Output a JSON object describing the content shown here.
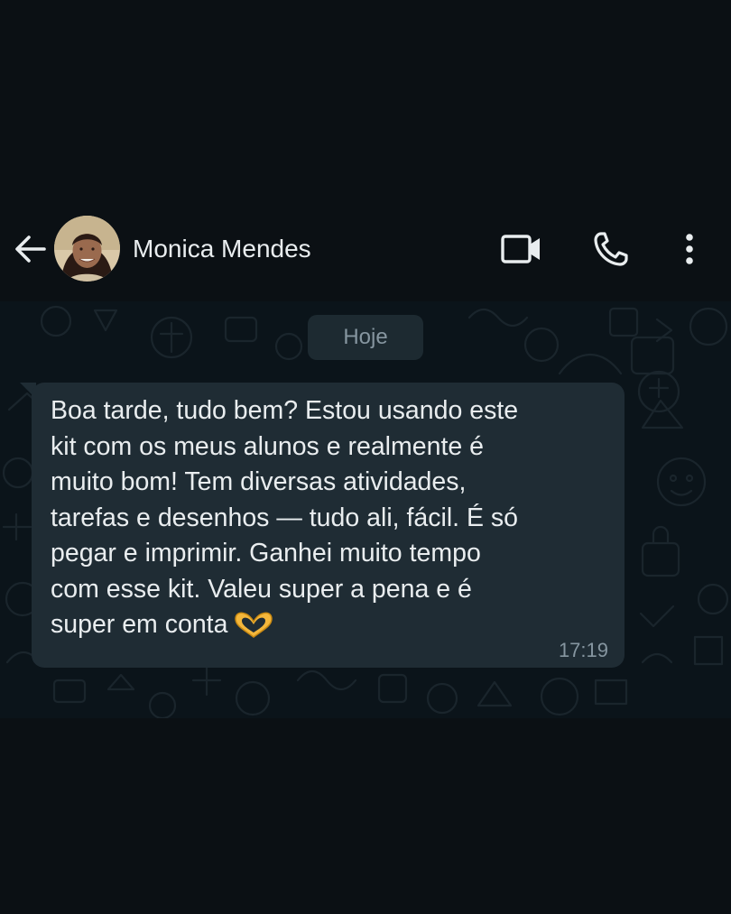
{
  "header": {
    "contact_name": "Monica Mendes"
  },
  "chat": {
    "date_chip": "Hoje",
    "messages": [
      {
        "text": "Boa tarde, tudo bem? Estou usando este\nkit com os meus alunos e realmente é\nmuito bom! Tem diversas atividades,\ntarefas e desenhos — tudo ali, fácil. É só\npegar e imprimir. Ganhei muito tempo\ncom esse kit. Valeu super a pena e é\nsuper em conta",
        "emoji": "heart-hands-emoji",
        "time": "17:19"
      }
    ]
  },
  "colors": {
    "background": "#0b1014",
    "chat_wallpaper": "#0b141a",
    "incoming_bubble": "#1f2c34",
    "primary_text": "#e9edef",
    "secondary_text": "#8696a0"
  },
  "icons": [
    "back-arrow-icon",
    "video-call-icon",
    "phone-call-icon",
    "more-options-icon"
  ]
}
